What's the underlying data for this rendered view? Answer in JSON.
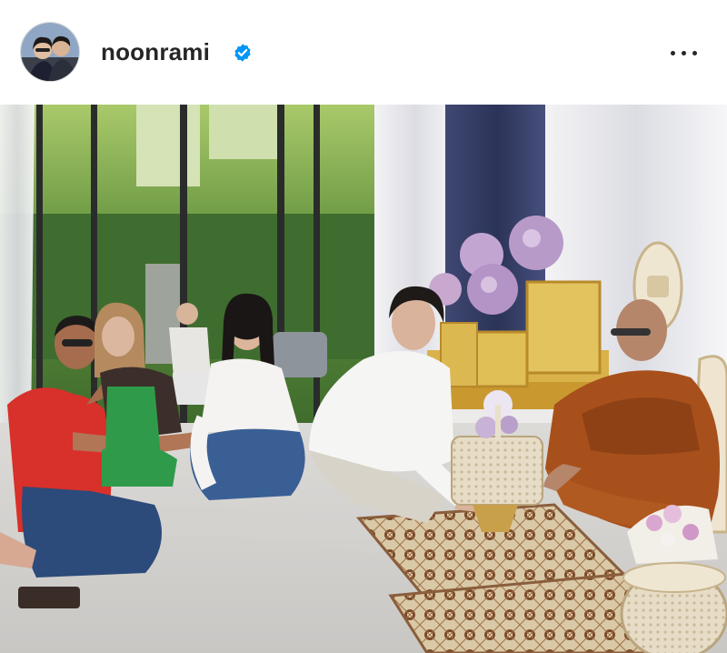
{
  "post": {
    "username": "noonrami",
    "verified": true,
    "icons": {
      "avatar": "profile-photo",
      "verified": "verified-badge-icon",
      "more": "more-options-icon"
    },
    "colors": {
      "verified_badge": "#0095f6",
      "username_text": "#262626",
      "robe": "#a8501c",
      "shirt_red": "#d8302a",
      "gold_altar": "#d9b24a"
    }
  }
}
